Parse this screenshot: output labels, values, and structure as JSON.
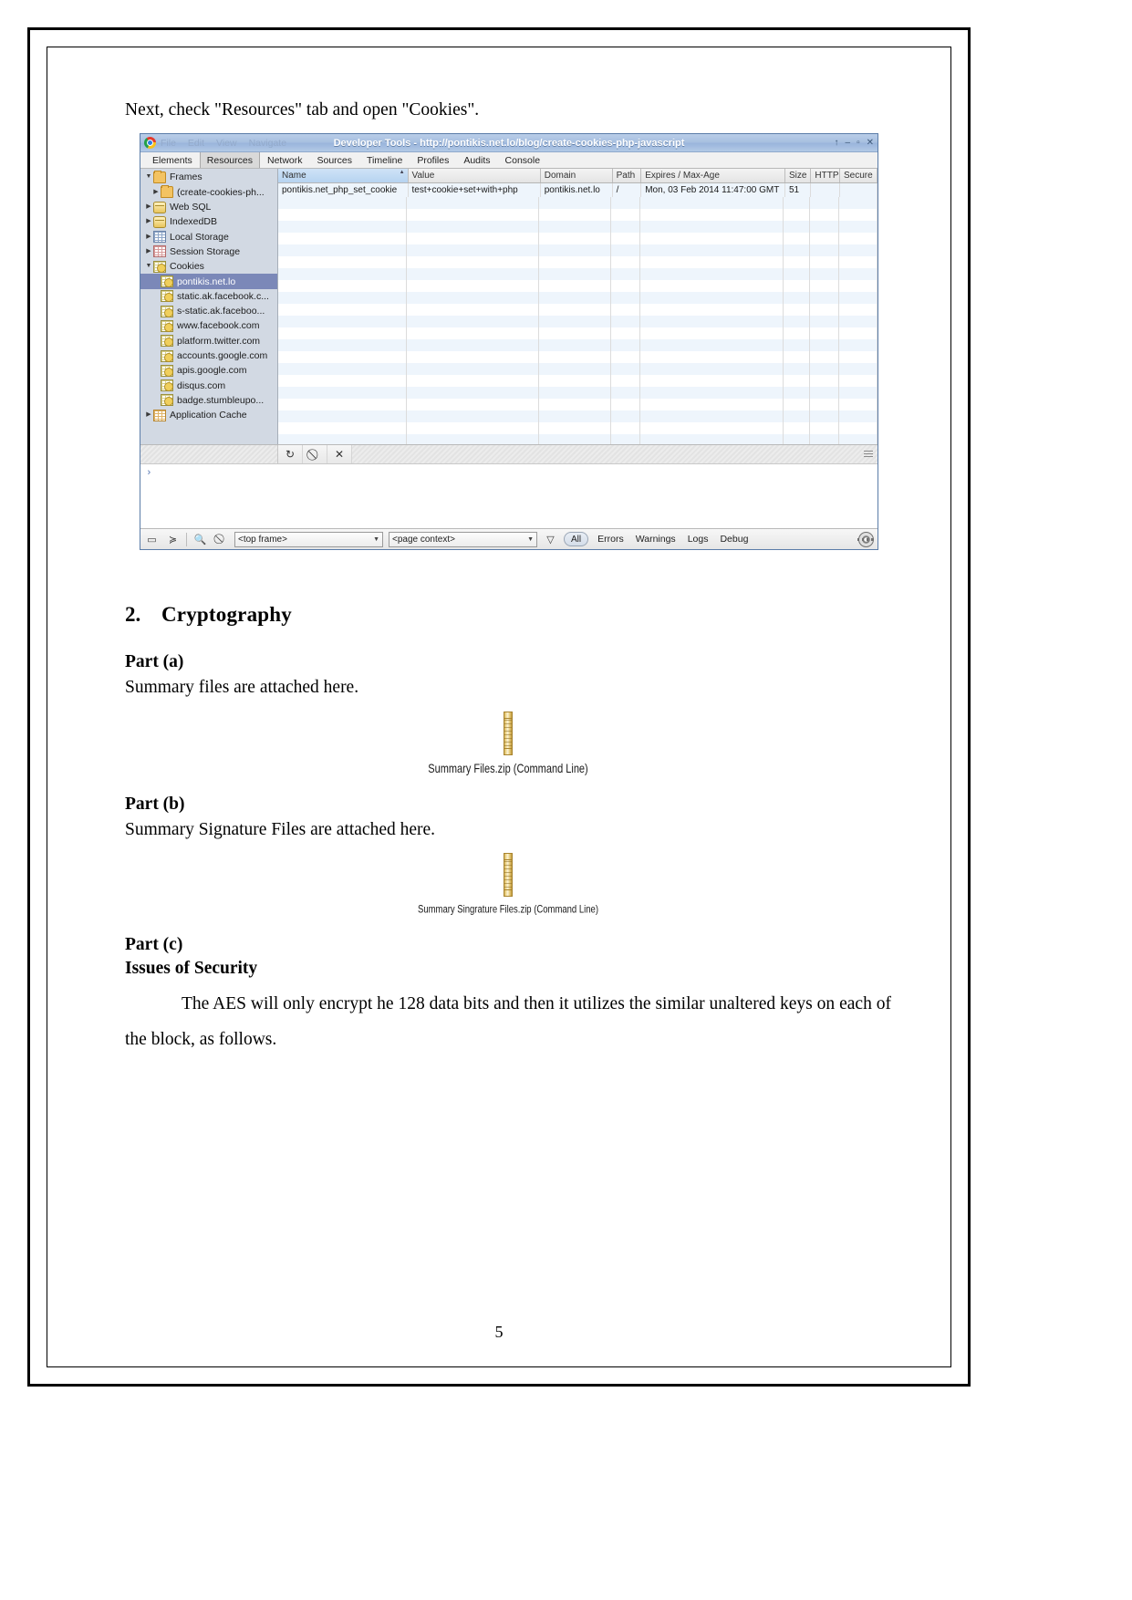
{
  "document": {
    "intro_line": "Next, check \"Resources\" tab and open \"Cookies\".",
    "section": {
      "number": "2.",
      "title": "Cryptography"
    },
    "part_a": {
      "heading": "Part (a)",
      "text": "Summary files are attached here.",
      "attachment_caption": "Summary Files.zip (Command Line)"
    },
    "part_b": {
      "heading": "Part (b)",
      "text": "Summary Signature Files are attached here.",
      "attachment_caption": "Summary Singrature Files.zip (Command Line)"
    },
    "part_c": {
      "heading": "Part (c)",
      "subheading": "Issues of Security",
      "body": "The AES will only encrypt he 128 data bits and then it utilizes the similar unaltered keys on each of the block, as follows."
    },
    "page_number": "5"
  },
  "devtools": {
    "titlebar": {
      "title": "Developer Tools - http://pontikis.net.lo/blog/create-cookies-php-javascript",
      "menu": [
        "File",
        "Edit",
        "View",
        "Navigate"
      ],
      "window_buttons": [
        "↑",
        "–",
        "▫",
        "✕"
      ]
    },
    "tabs": [
      {
        "label": "Elements",
        "active": false
      },
      {
        "label": "Resources",
        "active": true
      },
      {
        "label": "Network",
        "active": false
      },
      {
        "label": "Sources",
        "active": false
      },
      {
        "label": "Timeline",
        "active": false
      },
      {
        "label": "Profiles",
        "active": false
      },
      {
        "label": "Audits",
        "active": false
      },
      {
        "label": "Console",
        "active": false
      }
    ],
    "sidebar": [
      {
        "label": "Frames",
        "icon": "folder-icon",
        "twisty": "▼",
        "indent": 0,
        "selected": false
      },
      {
        "label": "(create-cookies-ph...",
        "icon": "folder-icon",
        "twisty": "▶",
        "indent": 1,
        "selected": false
      },
      {
        "label": "Web SQL",
        "icon": "database-icon",
        "twisty": "▶",
        "indent": 0,
        "selected": false
      },
      {
        "label": "IndexedDB",
        "icon": "database-icon",
        "twisty": "▶",
        "indent": 0,
        "selected": false
      },
      {
        "label": "Local Storage",
        "icon": "grid-blue-icon",
        "twisty": "▶",
        "indent": 0,
        "selected": false
      },
      {
        "label": "Session Storage",
        "icon": "grid-red-icon",
        "twisty": "▶",
        "indent": 0,
        "selected": false
      },
      {
        "label": "Cookies",
        "icon": "cookie-icon",
        "twisty": "▼",
        "indent": 0,
        "selected": false
      },
      {
        "label": "pontikis.net.lo",
        "icon": "cookie-icon",
        "twisty": "",
        "indent": 2,
        "selected": true
      },
      {
        "label": "static.ak.facebook.c...",
        "icon": "cookie-icon",
        "twisty": "",
        "indent": 2,
        "selected": false
      },
      {
        "label": "s-static.ak.faceboo...",
        "icon": "cookie-icon",
        "twisty": "",
        "indent": 2,
        "selected": false
      },
      {
        "label": "www.facebook.com",
        "icon": "cookie-icon",
        "twisty": "",
        "indent": 2,
        "selected": false
      },
      {
        "label": "platform.twitter.com",
        "icon": "cookie-icon",
        "twisty": "",
        "indent": 2,
        "selected": false
      },
      {
        "label": "accounts.google.com",
        "icon": "cookie-icon",
        "twisty": "",
        "indent": 2,
        "selected": false
      },
      {
        "label": "apis.google.com",
        "icon": "cookie-icon",
        "twisty": "",
        "indent": 2,
        "selected": false
      },
      {
        "label": "disqus.com",
        "icon": "cookie-icon",
        "twisty": "",
        "indent": 2,
        "selected": false
      },
      {
        "label": "badge.stumbleupo...",
        "icon": "cookie-icon",
        "twisty": "",
        "indent": 2,
        "selected": false
      },
      {
        "label": "Application Cache",
        "icon": "grid-orange-icon",
        "twisty": "▶",
        "indent": 0,
        "selected": false
      }
    ],
    "cookie_table": {
      "columns": [
        {
          "label": "Name",
          "sorted": true
        },
        {
          "label": "Value",
          "sorted": false
        },
        {
          "label": "Domain",
          "sorted": false
        },
        {
          "label": "Path",
          "sorted": false
        },
        {
          "label": "Expires / Max-Age",
          "sorted": false
        },
        {
          "label": "Size",
          "sorted": false
        },
        {
          "label": "HTTP",
          "sorted": false
        },
        {
          "label": "Secure",
          "sorted": false
        }
      ],
      "rows": [
        {
          "name": "pontikis.net_php_set_cookie",
          "value": "test+cookie+set+with+php",
          "domain": "pontikis.net.lo",
          "path": "/",
          "expires": "Mon, 03 Feb 2014 11:47:00 GMT",
          "size": "51",
          "http": "",
          "secure": ""
        }
      ]
    },
    "toolbar": {
      "refresh_icon": "↻",
      "clear_icon": "⃠",
      "delete_icon": "✕"
    },
    "console": {
      "prompt": "›"
    },
    "statusbar": {
      "dock_icon": "▭",
      "console_icon": "≽",
      "search_icon": "🔍",
      "clear_icon": "⃠",
      "frame_select": "<top frame>",
      "context_select": "<page context>",
      "filter_icon": "▽",
      "level_all": "All",
      "levels": [
        "Errors",
        "Warnings",
        "Logs",
        "Debug"
      ],
      "settings_icon": "gear-icon"
    }
  }
}
